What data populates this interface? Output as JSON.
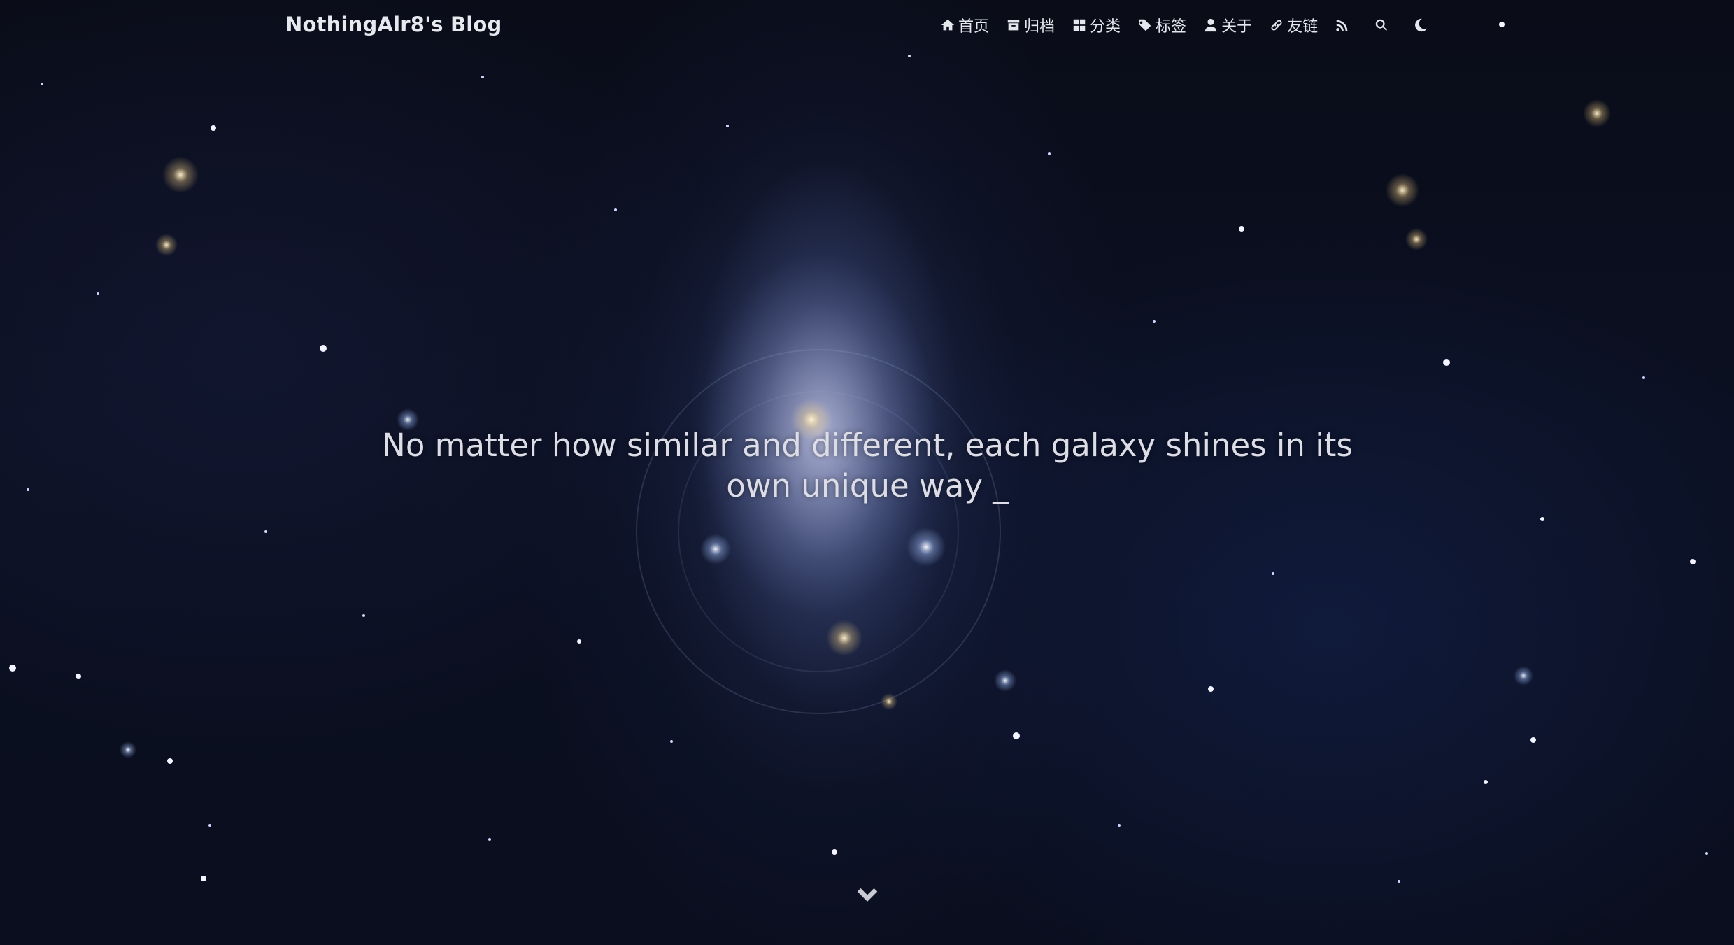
{
  "header": {
    "brand": "NothingAlr8's Blog",
    "menu": [
      {
        "label": "首页",
        "icon": "home-icon"
      },
      {
        "label": "归档",
        "icon": "archive-icon"
      },
      {
        "label": "分类",
        "icon": "grid-icon"
      },
      {
        "label": "标签",
        "icon": "tags-icon"
      },
      {
        "label": "关于",
        "icon": "user-icon"
      },
      {
        "label": "友链",
        "icon": "link-icon"
      }
    ],
    "icon_buttons": [
      "rss-icon",
      "search-icon",
      "moon-icon"
    ]
  },
  "hero": {
    "subtitle": "No matter how similar and different, each galaxy shines in its own unique way _",
    "scroll_icon": "chevron-down-icon"
  },
  "colors": {
    "text": "#e6e6ee",
    "background": "#0a0e1e"
  }
}
